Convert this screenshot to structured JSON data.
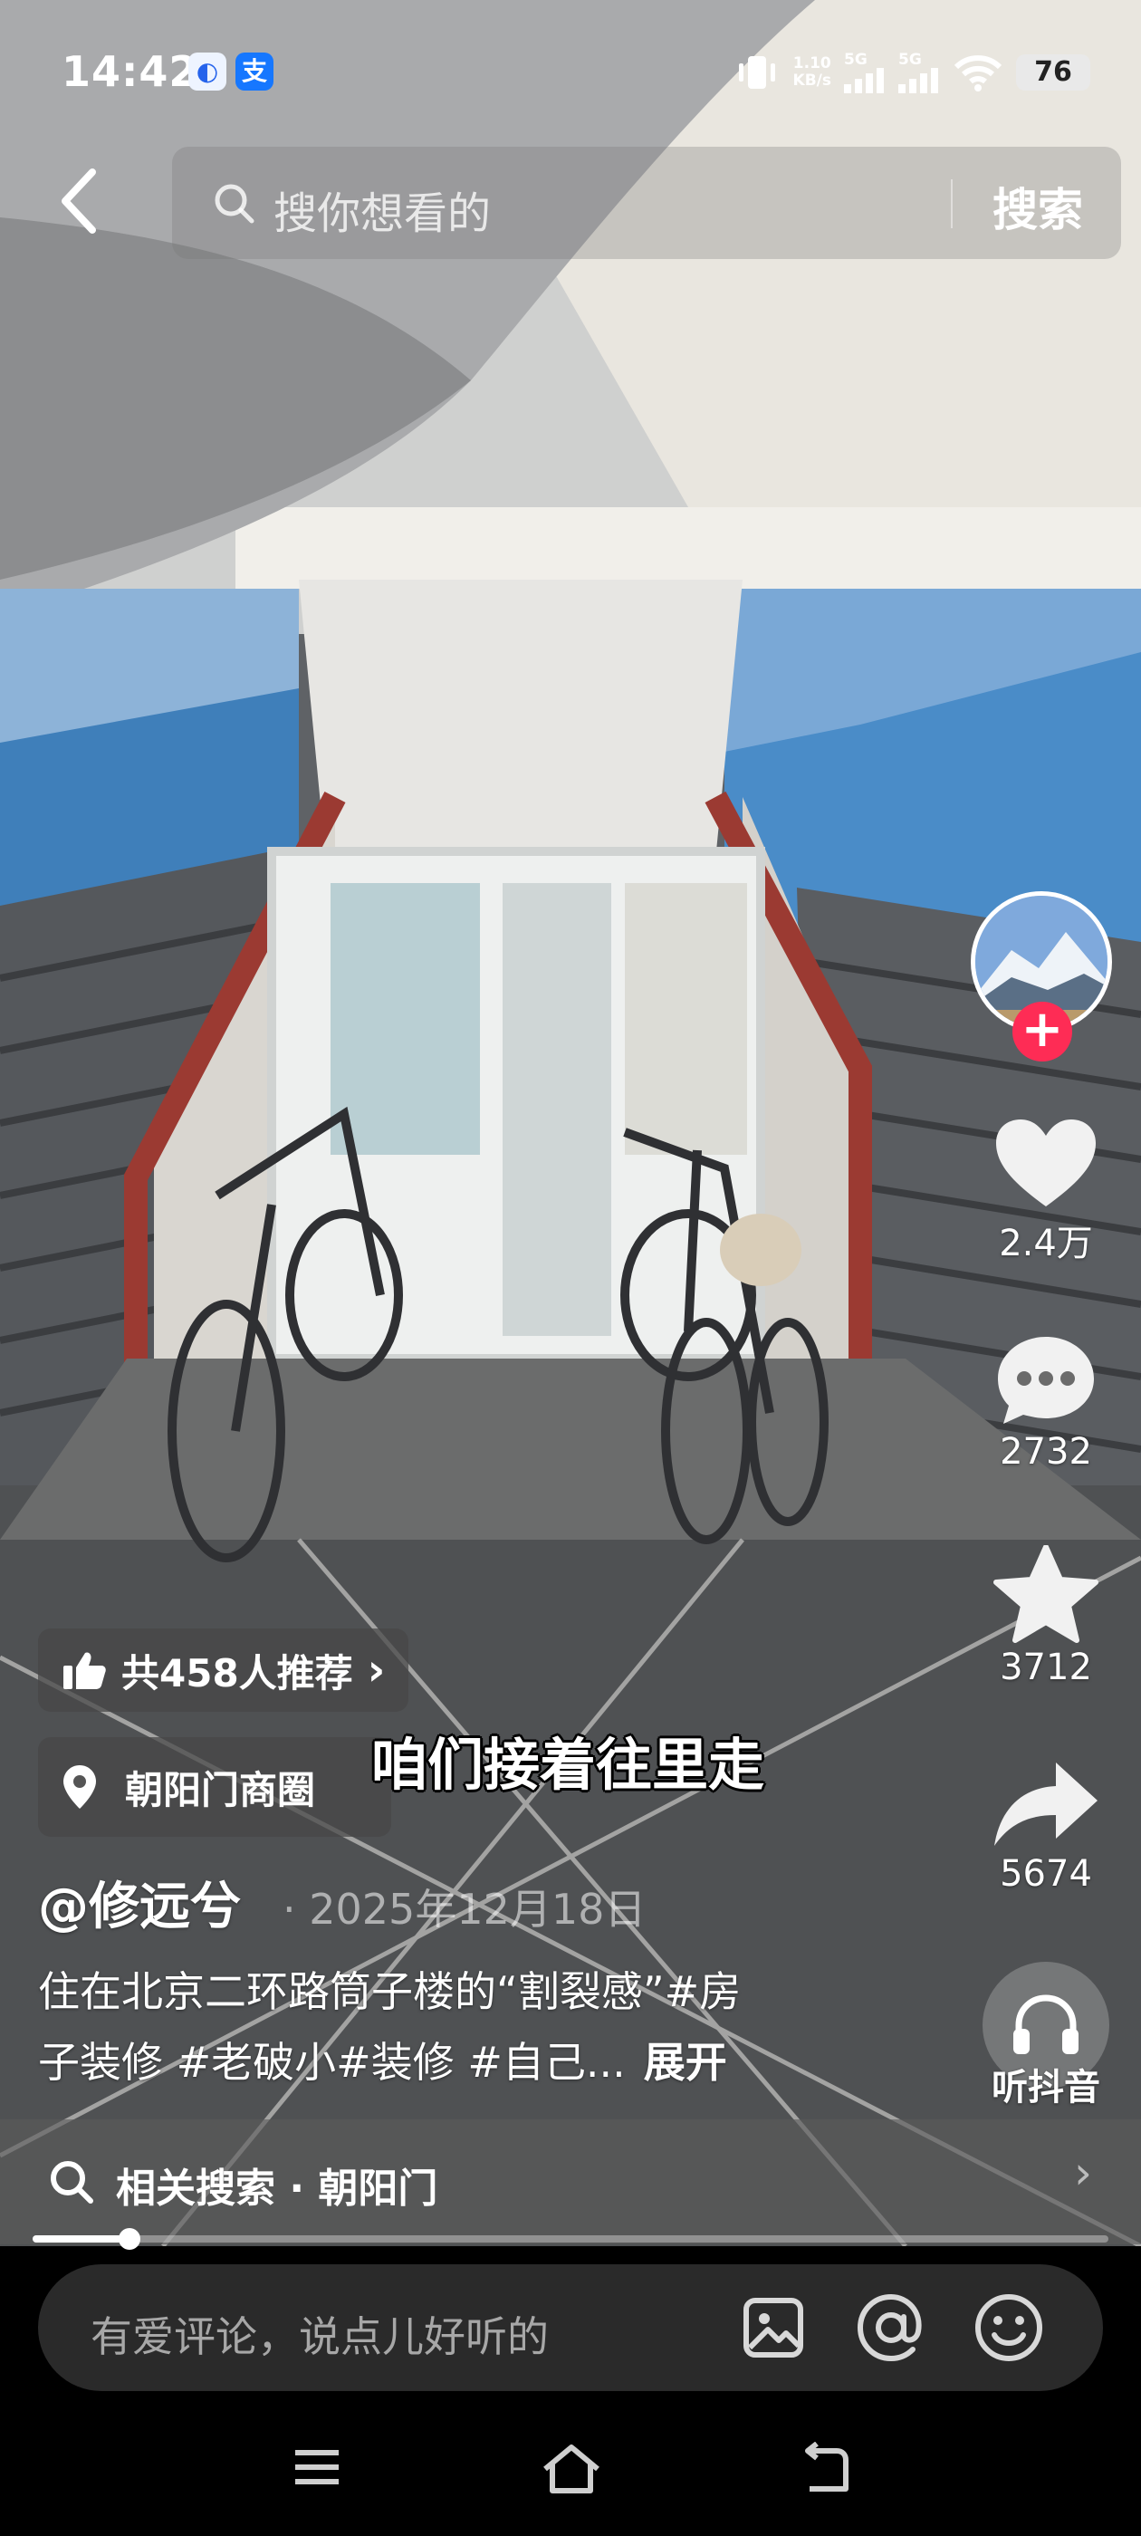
{
  "status_bar": {
    "time": "14:42",
    "apps": [
      {
        "name": "baidu-app-icon",
        "glyph": "◐"
      },
      {
        "name": "alipay-app-icon",
        "glyph": "支"
      }
    ],
    "net_speed_value": "1.10",
    "net_speed_unit": "KB/s",
    "signal_1": "5G",
    "signal_2": "5G",
    "battery": "76"
  },
  "search": {
    "placeholder": "搜你想看的",
    "button": "搜索"
  },
  "video": {
    "subtitle": "咱们接着往里走"
  },
  "actions": {
    "likes": "2.4万",
    "comments": "2732",
    "favorites": "3712",
    "shares": "5674",
    "listen_label": "听抖音",
    "follow": "+"
  },
  "info": {
    "recommend_text": "共458人推荐",
    "recommend_chevron": "›",
    "location": "朝阳门商圈",
    "author": "@修远兮",
    "date_sep": "·",
    "publish_date": "2025年12月18日",
    "caption_line1": "住在北京二环路筒子楼的“割裂感”#房",
    "caption_line2": "子装修 #老破小#装修 #自己...",
    "expand": "展开",
    "progress_fraction": 0.09
  },
  "related_search": {
    "text": "相关搜索 · 朝阳门",
    "chevron": "›"
  },
  "comment": {
    "placeholder": "有爱评论，说点儿好听的"
  },
  "colors": {
    "follow_red": "#fe2c55",
    "wall_blue": "#3d86c7",
    "handrail_red": "#9b3a32"
  }
}
